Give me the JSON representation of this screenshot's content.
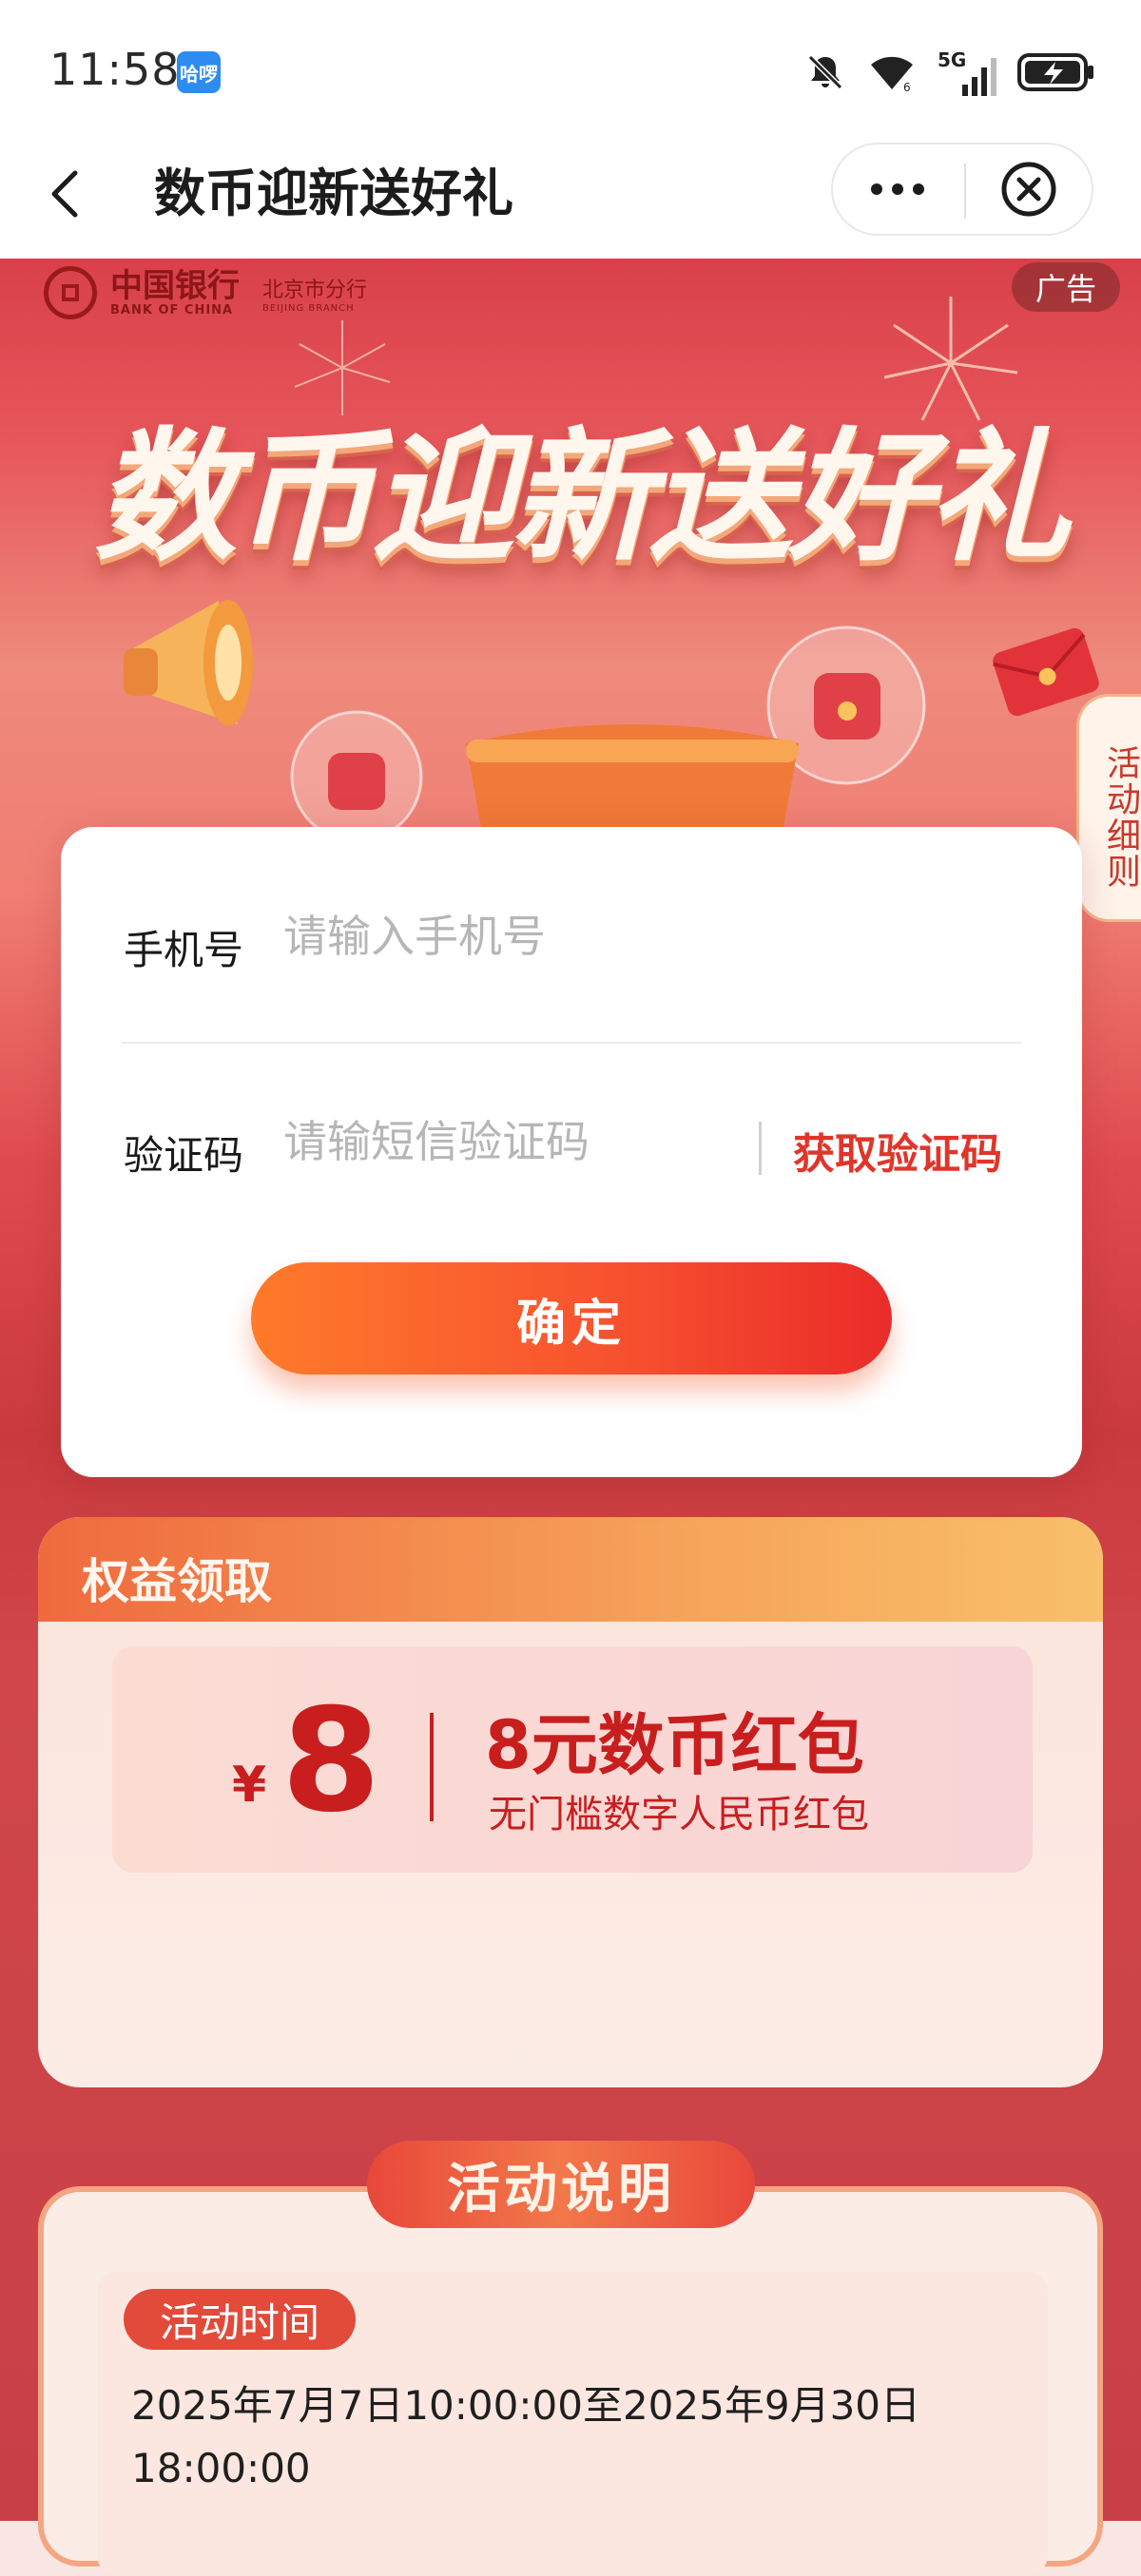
{
  "status_bar": {
    "time": "11:58",
    "app_badge": "哈啰",
    "network": "5G"
  },
  "nav": {
    "title": "数币迎新送好礼"
  },
  "banner": {
    "bank_name_cn": "中国银行",
    "bank_name_en": "BANK OF CHINA",
    "branch_cn": "北京市分行",
    "branch_en": "BEIJING BRANCH",
    "ad_tag": "广告",
    "hero_title": "数币迎新送好礼",
    "rules_tab": "活动细则"
  },
  "dialog": {
    "phone_label": "手机号",
    "phone_placeholder": "请输入手机号",
    "phone_value": "",
    "code_label": "验证码",
    "code_placeholder": "请输短信验证码",
    "code_value": "",
    "get_code_label": "获取验证码",
    "confirm_label": "确定"
  },
  "rights": {
    "title": "权益领取",
    "currency_symbol": "¥",
    "amount": "8",
    "name": "8元数币红包",
    "description": "无门槛数字人民币红包"
  },
  "notes": {
    "title": "活动说明",
    "time_tag": "活动时间",
    "time_text": "2025年7月7日10:00:00至2025年9月30日18:00:00"
  },
  "colors": {
    "accent_red": "#e0352b",
    "button_start": "#ff7a2a",
    "button_end": "#ea2c2a"
  }
}
